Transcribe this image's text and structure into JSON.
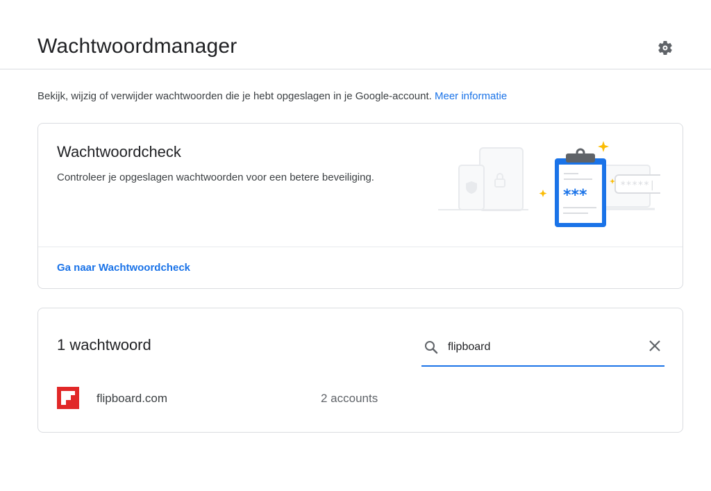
{
  "header": {
    "title": "Wachtwoordmanager",
    "settings_icon": "gear-icon"
  },
  "intro": {
    "text": "Bekijk, wijzig of verwijder wachtwoorden die je hebt opgeslagen in je Google-account.",
    "link": "Meer informatie"
  },
  "password_check": {
    "title": "Wachtwoordcheck",
    "description": "Controleer je opgeslagen wachtwoorden voor een betere beveiliging.",
    "illustration_text": "***",
    "illustration_field": "*****|",
    "link": "Ga naar Wachtwoordcheck"
  },
  "passwords": {
    "count_label": "1 wachtwoord",
    "search": {
      "value": "flipboard",
      "icon": "search-icon",
      "clear_icon": "close-icon"
    },
    "rows": [
      {
        "site": "flipboard.com",
        "accounts": "2 accounts",
        "icon": "flipboard-favicon"
      }
    ]
  },
  "colors": {
    "accent": "#1a73e8",
    "flipboard_red": "#e12828",
    "clipboard_blue": "#1a73e8",
    "sparkle": "#fbbc04"
  }
}
